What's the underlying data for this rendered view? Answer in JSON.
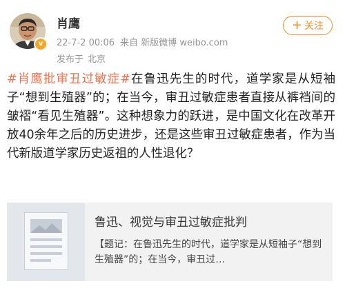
{
  "post": {
    "author": {
      "name": "肖鹰",
      "avatar": "avatar-photo",
      "verified_badge": "v"
    },
    "follow_button": {
      "icon": "+",
      "label": "关注"
    },
    "meta": {
      "timestamp": "22-7-2 00:06",
      "source": "来自 新版微博 weibo.com"
    },
    "location": {
      "label": "发布于",
      "place": "北京"
    },
    "content": {
      "hashtag": "#肖鹰批审丑过敏症#",
      "text": "在鲁迅先生的时代，道学家是从短袖子“想到生殖器”的；在当今，审丑过敏症患者直接从裤裆间的皱褶“看见生殖器”。这种想象力的跃进，是中国文化在改革开放40余年之后的历史进步，还是这些审丑过敏症患者，作为当代新版道学家历史返祖的人性退化？"
    },
    "article_card": {
      "thumbnail_icon": "document-icon",
      "title": "鲁迅、视觉与审丑过敏症批判",
      "summary": "【题记：在鲁迅先生的时代，道学家是从短袖子“想到生殖器”的；在当今，审丑过…"
    }
  },
  "colors": {
    "hashtag": "#eb7350",
    "follow": "#f08c2c",
    "meta_text": "#939393",
    "badge": "#f6a623",
    "card_bg": "#f2f2f2"
  }
}
